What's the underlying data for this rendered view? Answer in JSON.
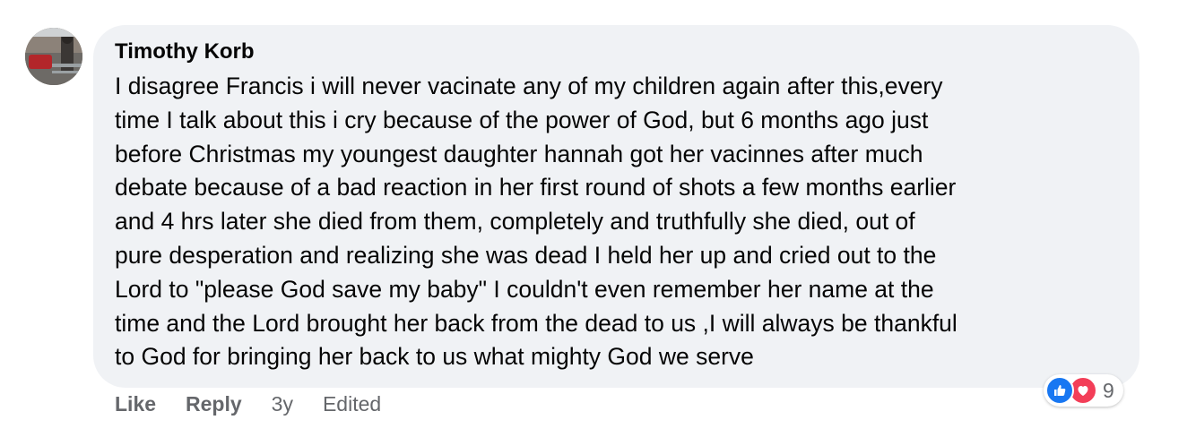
{
  "comment": {
    "author": "Timothy Korb",
    "lines": [
      "I disagree Francis i will never vacinate any of my children again after this,every",
      "time I talk about this i cry because of the power of God, but 6 months ago just",
      "before Christmas my youngest daughter hannah got her vacinnes after much",
      "debate because of a bad reaction in her first round of shots a few months earlier",
      "and 4 hrs later she died from them, completely and truthfully she died, out of",
      "pure desperation and realizing she was dead I held her up and cried out to the",
      "Lord to \"please God save my baby\" I couldn't even remember her name at the",
      "time and the Lord brought her back from the dead to us ,I will always be thankful",
      "to God for bringing her back to us what mighty God we serve"
    ]
  },
  "actions": {
    "like_label": "Like",
    "reply_label": "Reply",
    "timestamp": "3y",
    "edited_label": "Edited"
  },
  "reactions": {
    "icons": [
      "like-icon",
      "love-icon"
    ],
    "count": "9",
    "colors": {
      "like": "#1877f2",
      "love": "#f33e58"
    }
  },
  "theme": {
    "bubble_bg": "#f0f2f5",
    "secondary_text": "#65676b"
  }
}
